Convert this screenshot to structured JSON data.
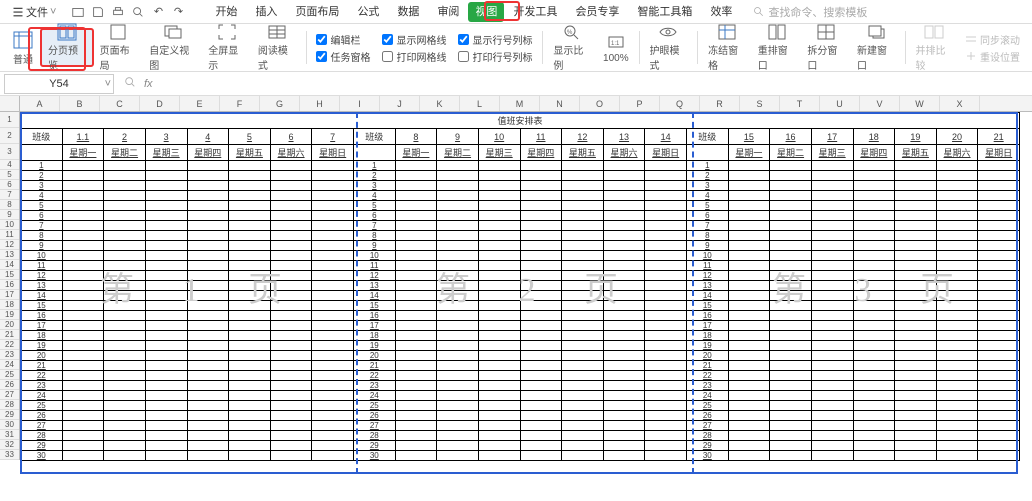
{
  "menu": {
    "file": "文件",
    "tabs": [
      "开始",
      "插入",
      "页面布局",
      "公式",
      "数据",
      "审阅",
      "视图",
      "开发工具",
      "会员专享",
      "智能工具箱",
      "效率"
    ],
    "active_tab_index": 6,
    "search_placeholder": "查找命令、搜索模板"
  },
  "ribbon": {
    "normal": "普通",
    "pagebreak": "分页预览",
    "pagelayout": "页面布局",
    "custom": "自定义视图",
    "fullscreen": "全屏显示",
    "readmode": "阅读模式",
    "formula_bar": "编辑栏",
    "gridlines": "显示网格线",
    "headings": "显示行号列标",
    "taskpane": "任务窗格",
    "print_grid": "打印网格线",
    "print_head": "打印行号列标",
    "zoom": "显示比例",
    "zoom100": "100%",
    "protect": "护眼模式",
    "freeze": "冻结窗格",
    "arrange": "重排窗口",
    "split": "拆分窗口",
    "newwin": "新建窗口",
    "compare": "并排比较",
    "syncscroll": "同步滚动",
    "resetpos": "重设位置"
  },
  "namebox": {
    "value": "Y54",
    "fx": "fx"
  },
  "sheet": {
    "title": "值班安排表",
    "group_label": "班级",
    "dates_p1": [
      "1.1",
      "2",
      "3",
      "4",
      "5",
      "6",
      "7"
    ],
    "dates_p2": [
      "8",
      "9",
      "10",
      "11",
      "12",
      "13",
      "14"
    ],
    "dates_p3": [
      "15",
      "16",
      "17",
      "18",
      "19",
      "20",
      "21"
    ],
    "days": [
      "星期一",
      "星期二",
      "星期三",
      "星期四",
      "星期五",
      "星期六",
      "星期日"
    ],
    "row_numbers": [
      "1",
      "2",
      "3",
      "4",
      "5",
      "6",
      "7",
      "8",
      "9",
      "10",
      "11",
      "12",
      "13",
      "14",
      "15",
      "16",
      "17",
      "18",
      "19",
      "20",
      "21",
      "22",
      "23",
      "24",
      "25",
      "26",
      "27",
      "28",
      "29",
      "30"
    ],
    "watermarks": [
      "第 1 页",
      "第 2 页",
      "第 3 页"
    ]
  },
  "columns": [
    "A",
    "B",
    "C",
    "D",
    "E",
    "F",
    "G",
    "H",
    "I",
    "J",
    "K",
    "L",
    "M",
    "N",
    "O",
    "P",
    "Q",
    "R",
    "S",
    "T",
    "U",
    "V",
    "W",
    "X"
  ]
}
